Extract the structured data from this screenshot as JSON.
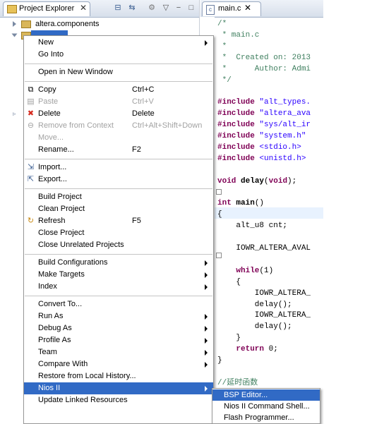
{
  "project_explorer": {
    "title": "Project Explorer",
    "close_glyph": "✕",
    "toolbar_icons": [
      "collapse-all-icon",
      "link-with-editor-icon",
      "view-menu-icon",
      "minimize-icon",
      "maximize-icon"
    ],
    "tree": [
      {
        "label": "altera.components",
        "selected": false
      },
      {
        "label": "",
        "selected": true
      }
    ]
  },
  "editor": {
    "tab_label": "main.c",
    "close_glyph": "✕",
    "code": [
      {
        "text": "/*",
        "cls": "c-comment"
      },
      {
        "text": " * main.c",
        "cls": "c-comment"
      },
      {
        "text": " *",
        "cls": "c-comment"
      },
      {
        "text": " *  Created on: 2013",
        "cls": "c-comment"
      },
      {
        "text": " *      Author: Admi",
        "cls": "c-comment"
      },
      {
        "text": " */",
        "cls": "c-comment"
      },
      {
        "text": "",
        "cls": ""
      },
      {
        "text": "#include \"alt_types.",
        "cls": "c-inc"
      },
      {
        "text": "#include \"altera_ava",
        "cls": "c-inc"
      },
      {
        "text": "#include \"sys/alt_ir",
        "cls": "c-inc"
      },
      {
        "text": "#include \"system.h\"",
        "cls": "c-inc"
      },
      {
        "text": "#include <stdio.h>",
        "cls": "c-inc"
      },
      {
        "text": "#include <unistd.h>",
        "cls": "c-inc"
      },
      {
        "text": "",
        "cls": ""
      },
      {
        "text": "void delay(void);",
        "cls": "c-decl"
      },
      {
        "text": "",
        "cls": ""
      },
      {
        "text": "int main()",
        "cls": "c-decl"
      },
      {
        "text": "{",
        "cls": ""
      },
      {
        "text": "    alt_u8 cnt;",
        "cls": ""
      },
      {
        "text": "",
        "cls": ""
      },
      {
        "text": "    IOWR_ALTERA_AVAL",
        "cls": ""
      },
      {
        "text": "",
        "cls": ""
      },
      {
        "text": "    while(1)",
        "cls": "c-while"
      },
      {
        "text": "    {",
        "cls": ""
      },
      {
        "text": "        IOWR_ALTERA_",
        "cls": ""
      },
      {
        "text": "        delay();",
        "cls": ""
      },
      {
        "text": "        IOWR_ALTERA_",
        "cls": ""
      },
      {
        "text": "        delay();",
        "cls": ""
      },
      {
        "text": "    }",
        "cls": ""
      },
      {
        "text": "    return 0;",
        "cls": "c-return"
      },
      {
        "text": "}",
        "cls": ""
      },
      {
        "text": "",
        "cls": ""
      },
      {
        "text": "//延时函数",
        "cls": "c-comment"
      }
    ]
  },
  "context_menu": {
    "items": [
      {
        "label": "New",
        "submenu": true
      },
      {
        "label": "Go Into"
      },
      {
        "sep": true
      },
      {
        "label": "Open in New Window"
      },
      {
        "sep": true
      },
      {
        "label": "Copy",
        "accel": "Ctrl+C",
        "icon": "copy-icon",
        "glyph": "⧉"
      },
      {
        "label": "Paste",
        "accel": "Ctrl+V",
        "icon": "paste-icon",
        "glyph": "▤",
        "disabled": true
      },
      {
        "label": "Delete",
        "accel": "Delete",
        "icon": "delete-icon",
        "glyph": "✖",
        "icon_color": "#d62b1f"
      },
      {
        "label": "Remove from Context",
        "accel": "Ctrl+Alt+Shift+Down",
        "icon": "remove-context-icon",
        "glyph": "⊖",
        "disabled": true
      },
      {
        "label": "Move...",
        "disabled": true
      },
      {
        "label": "Rename...",
        "accel": "F2"
      },
      {
        "sep": true
      },
      {
        "label": "Import...",
        "icon": "import-icon",
        "glyph": "⇲",
        "icon_color": "#3b5e91"
      },
      {
        "label": "Export...",
        "icon": "export-icon",
        "glyph": "⇱",
        "icon_color": "#3b5e91"
      },
      {
        "sep": true
      },
      {
        "label": "Build Project"
      },
      {
        "label": "Clean Project"
      },
      {
        "label": "Refresh",
        "accel": "F5",
        "icon": "refresh-icon",
        "glyph": "↻",
        "icon_color": "#c98a14"
      },
      {
        "label": "Close Project"
      },
      {
        "label": "Close Unrelated Projects"
      },
      {
        "sep": true
      },
      {
        "label": "Build Configurations",
        "submenu": true
      },
      {
        "label": "Make Targets",
        "submenu": true
      },
      {
        "label": "Index",
        "submenu": true
      },
      {
        "sep": true
      },
      {
        "label": "Convert To..."
      },
      {
        "label": "Run As",
        "submenu": true
      },
      {
        "label": "Debug As",
        "submenu": true
      },
      {
        "label": "Profile As",
        "submenu": true
      },
      {
        "label": "Team",
        "submenu": true
      },
      {
        "label": "Compare With",
        "submenu": true
      },
      {
        "label": "Restore from Local History..."
      },
      {
        "label": "Nios II",
        "submenu": true,
        "active": true
      },
      {
        "label": "Update Linked Resources"
      }
    ]
  },
  "submenu_nios": {
    "items": [
      {
        "label": "BSP Editor...",
        "active": true
      },
      {
        "label": "Nios II Command Shell..."
      },
      {
        "label": "Flash Programmer..."
      }
    ]
  }
}
